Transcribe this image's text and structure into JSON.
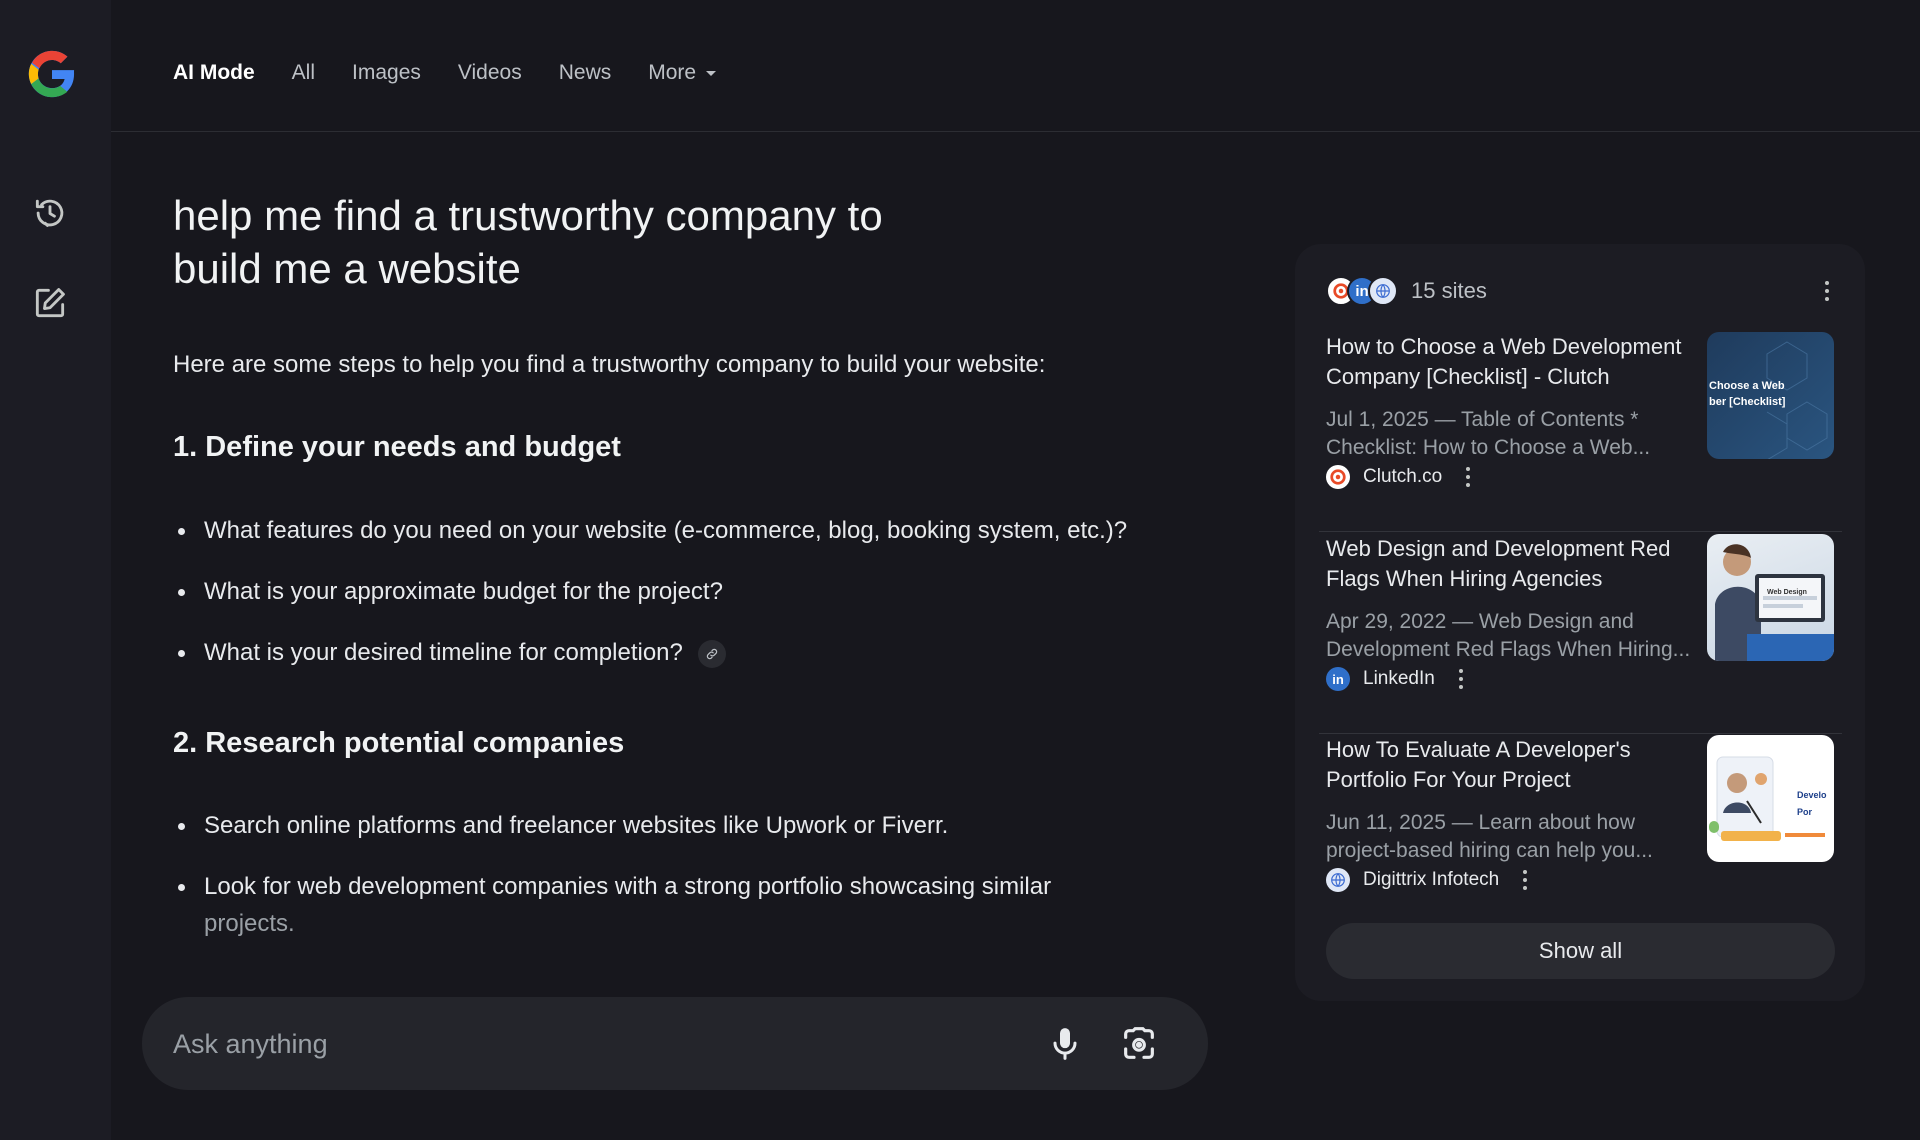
{
  "nav": {
    "tabs": [
      {
        "label": "AI Mode"
      },
      {
        "label": "All"
      },
      {
        "label": "Images"
      },
      {
        "label": "Videos"
      },
      {
        "label": "News"
      },
      {
        "label": "More"
      }
    ]
  },
  "rail": {
    "icons": [
      "google-logo",
      "history-icon",
      "new-chat-icon"
    ]
  },
  "answer": {
    "query": "help me find a trustworthy company to build me a website",
    "intro": "Here are some steps to help you find a trustworthy company to build your website:",
    "sections": [
      {
        "heading": "1. Define your needs and budget",
        "bullets": [
          "What features do you need on your website (e-commerce, blog, booking system, etc.)?",
          "What is your approximate budget for the project?",
          "What is your desired timeline for completion?"
        ]
      },
      {
        "heading": "2. Research potential companies",
        "bullets": [
          "Search online platforms and freelancer websites like Upwork or Fiverr.",
          "Look for web development companies with a strong portfolio showcasing similar",
          "projects."
        ]
      }
    ]
  },
  "ask": {
    "placeholder": "Ask anything"
  },
  "sources": {
    "count_label": "15 sites",
    "items": [
      {
        "title": "How to Choose a Web Development Company [Checklist] - Clutch",
        "snippet": "Jul 1, 2025 — Table of Contents * Checklist: How to Choose a Web...",
        "site": "Clutch.co",
        "thumb_text": "Choose a Web ber [Checklist]"
      },
      {
        "title": "Web Design and Development Red Flags When Hiring Agencies",
        "snippet": "Apr 29, 2022 — Web Design and Development Red Flags When Hiring...",
        "site": "LinkedIn",
        "thumb_text": "Web Design"
      },
      {
        "title": "How To Evaluate A Developer's Portfolio For Your Project",
        "snippet": "Jun 11, 2025 — Learn about how project-based hiring can help you...",
        "site": "Digittrix Infotech",
        "thumb_text": "Develo Por"
      }
    ],
    "show_all_label": "Show all"
  },
  "colors": {
    "background": "#17171d",
    "rail": "#1c1c24",
    "panel": "#1c1c23",
    "text": "#e8eaed",
    "muted": "#9aa0a6",
    "clutch": "#e84a27",
    "linkedin": "#2f6fc9",
    "digittrix": "#6a8fd6"
  }
}
